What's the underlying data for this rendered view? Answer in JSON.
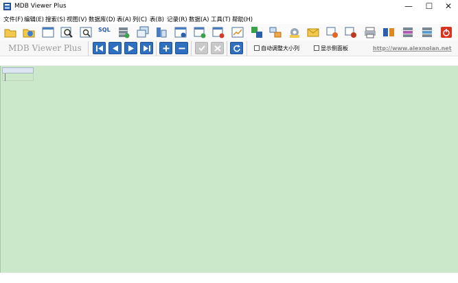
{
  "window": {
    "title": "MDB Viewer Plus"
  },
  "window_controls": {
    "minimize": "—",
    "maximize": "☐",
    "close": "✕"
  },
  "menu": [
    "文件(F)",
    "编辑(E)",
    "搜索(S)",
    "视图(V)",
    "数据库(D)",
    "表(A)",
    "列(C)",
    "表(B)",
    "记录(R)",
    "数据(A)",
    "工具(T)",
    "帮助(H)"
  ],
  "toolbar": {
    "icons": [
      "open-folder-icon",
      "open-recent-icon",
      "table-view-icon",
      "search-icon",
      "query-icon",
      "sql-icon",
      "database-add-icon",
      "tables-icon",
      "columns-icon",
      "table-info-icon",
      "table-add-icon",
      "table-remove-icon",
      "chart-icon",
      "rename-icon",
      "relations-icon",
      "settings-icon",
      "export-icon",
      "import-icon",
      "import-export-icon",
      "print-icon",
      "compare-icon",
      "sync-icon",
      "database-config-icon",
      "power-icon"
    ],
    "sql_label": "SQL"
  },
  "brand": "MDB Viewer Plus",
  "navigation": {
    "first": "first-record-icon",
    "prev": "previous-record-icon",
    "next": "next-record-icon",
    "last": "last-record-icon",
    "add": "add-record-icon",
    "delete": "delete-record-icon",
    "save": "save-record-icon",
    "cancel": "cancel-record-icon",
    "refresh": "refresh-icon"
  },
  "options": {
    "auto_resize": "自动调整大小列",
    "show_side_panel": "显示侧面板"
  },
  "website": "http://www.alexnolan.net",
  "colors": {
    "grid_bg": "#cbe8cb",
    "nav_blue": "#2f6fbf",
    "link_gray": "#8a8a8a"
  }
}
